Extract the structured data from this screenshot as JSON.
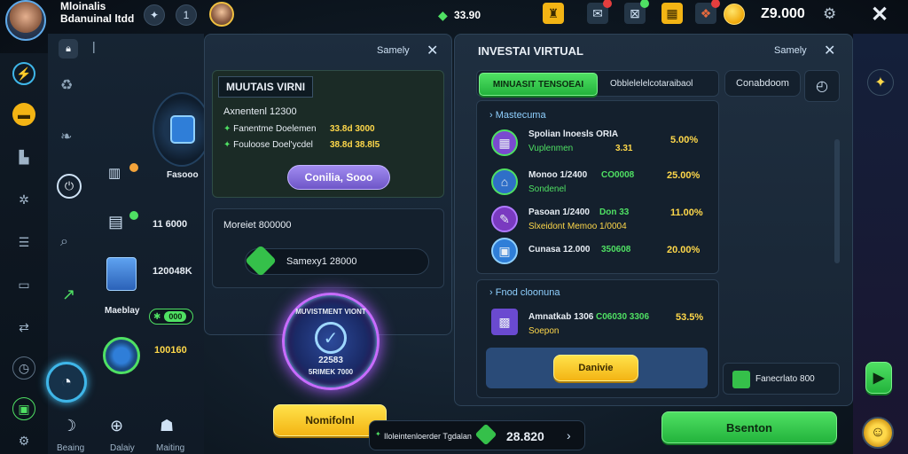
{
  "top": {
    "player_name_line1": "Mloinalis",
    "player_name_line2": "Bdanuinal ltdd",
    "currency_gem_value": "33.90",
    "gold_value": "Z9.000"
  },
  "left_rail": {
    "items": [
      "",
      "",
      "",
      "",
      "",
      "",
      "",
      "",
      "",
      "",
      ""
    ],
    "bottom_labels": [
      "Beaing",
      "Dalaiy",
      "Maiting"
    ]
  },
  "side_list": {
    "items": [
      {
        "label": "Fasooo",
        "value": ""
      },
      {
        "label": "",
        "value": "11 6000"
      },
      {
        "label": "",
        "value": "120048K"
      },
      {
        "label": "Maeblay",
        "value": "000"
      },
      {
        "label": "",
        "value": "100160"
      }
    ]
  },
  "panel_left": {
    "header_label": "Samely",
    "card1": {
      "title": "MUUTAIS VIRNI",
      "subtitle": "Axnentenl 12300",
      "line1_label": "Fanentme Doelemen",
      "line1_value": "33.8d 3000",
      "line2_label": "Fouloose Doel'ycdel",
      "line2_value": "38.8d 38.8l5",
      "button": "Conilia, Sooo"
    },
    "card2": {
      "title": "Moreiet 800000",
      "value": "Samexy1 28000"
    },
    "badge_text_top": "MUVISTMENT VIONT",
    "badge_value": "22583",
    "badge_text_bottom": "5RIMEK 7000",
    "bottom_button": "Nomifolnl"
  },
  "bottom_center": {
    "label": "Iloleintenloerder Tgdalan",
    "value": "28.820"
  },
  "panel_right": {
    "title": "INVESTAI VIRTUAL",
    "header_label": "Samely",
    "tabs": [
      "MINUASIT TENSOEAI",
      "Obblelelelcotaraibaol",
      "Conabdoom"
    ],
    "section1_title": "Mastecuma",
    "rows": [
      {
        "name": "Spolian lnoesls ORIA",
        "sub": "Vuplenmen",
        "amount": "3.31",
        "pct": "5.00%"
      },
      {
        "name": "Monoo 1/2400",
        "sub": "Sondenel",
        "amount": "CO0008",
        "pct": "25.00%"
      },
      {
        "name": "Pasoan 1/2400",
        "sub": "Slxeidont Memoo 1/0004",
        "amount": "Don 33",
        "pct": "11.00%"
      },
      {
        "name": "Cunasa 12.000",
        "sub": "",
        "amount": "350608",
        "pct": "20.00%"
      }
    ],
    "section2_title": "Fnod cloonuna",
    "row2": {
      "name": "Amnatkab 1306",
      "sub": "Soepon",
      "amount": "C06030 3306",
      "pct": "53.5%"
    },
    "inner_button": "Danivie",
    "side_card": "Fanecrlato 800",
    "bottom_button": "Bsenton"
  },
  "colors": {
    "accent_yellow": "#f3b414",
    "accent_green": "#23b33c",
    "accent_purple": "#6e56c8",
    "panel_bg": "#1f2f40"
  }
}
